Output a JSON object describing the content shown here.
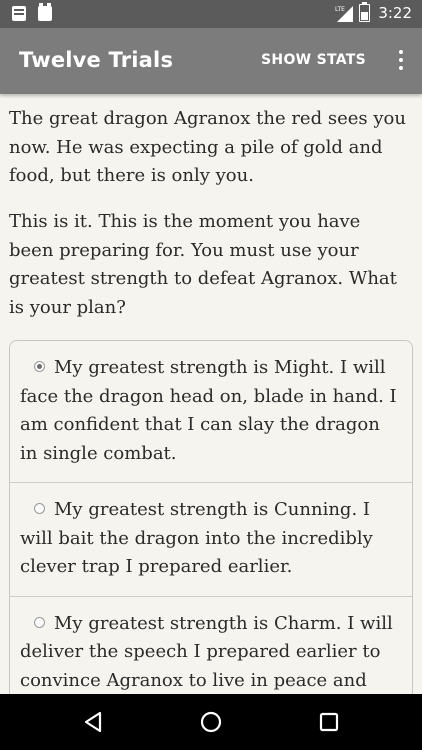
{
  "status_bar": {
    "time": "3:22",
    "icons": [
      "document-notification-icon",
      "cat-notification-icon",
      "lte-signal-icon",
      "battery-icon"
    ],
    "network_label": "LTE"
  },
  "app_bar": {
    "title": "Twelve Trials",
    "show_stats_label": "SHOW STATS",
    "overflow_icon": "more-vert-icon"
  },
  "story": {
    "paragraphs": [
      "The great dragon Agranox the red sees you now. He was expecting a pile of gold and food, but there is only you.",
      "This is it. This is the moment you have been preparing for. You must use your greatest strength to defeat Agranox. What is your plan?"
    ]
  },
  "choices": [
    {
      "text": "My greatest strength is Might. I will face the dragon head on, blade in hand. I am confident that I can slay the dragon in single combat.",
      "selected": true
    },
    {
      "text": "My greatest strength is Cunning. I will bait the dragon into the incredibly clever trap I prepared earlier.",
      "selected": false
    },
    {
      "text": "My greatest strength is Charm. I will deliver the speech I prepared earlier to convince Agranox to live in peace and harmony with the villagers.",
      "selected": false
    }
  ],
  "nav_bar": {
    "back_icon": "back-triangle-icon",
    "home_icon": "home-circle-icon",
    "recents_icon": "recents-square-icon"
  },
  "colors": {
    "status_bar": "#5b5b5b",
    "app_bar": "#7c7c7c",
    "background": "#f6f4ef",
    "text": "#2a2a2a"
  }
}
